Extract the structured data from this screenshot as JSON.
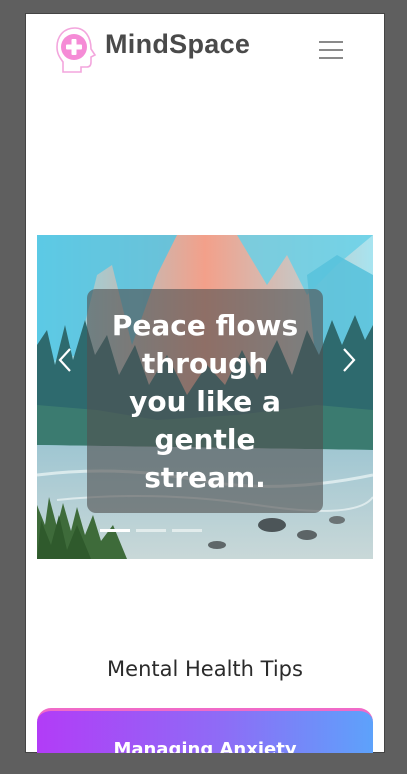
{
  "header": {
    "brand": "MindSpace",
    "logo_icon": "head-with-cross-icon",
    "menu_icon": "hamburger-menu-icon"
  },
  "carousel": {
    "caption": "Peace flows through you like a gentle stream.",
    "prev_icon": "chevron-left-icon",
    "next_icon": "chevron-right-icon",
    "slide_count": 3,
    "active_slide": 1
  },
  "tips": {
    "title": "Mental Health Tips",
    "cards": [
      {
        "title": "Managing Anxiety"
      }
    ]
  },
  "colors": {
    "brand_text": "#4a4a4a",
    "logo_pink": "#f58bd6",
    "card_gradient_start": "#b23cf7",
    "card_gradient_end": "#5da2fb"
  }
}
